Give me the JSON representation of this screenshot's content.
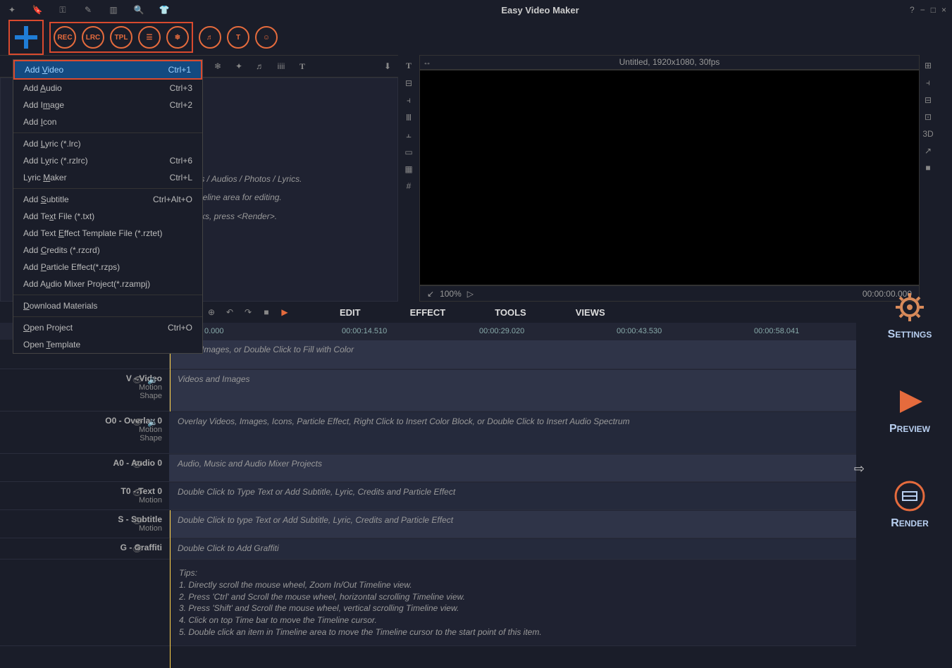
{
  "app_title": "Easy Video Maker",
  "window_controls": {
    "help": "?",
    "min": "−",
    "max": "□",
    "close": "×"
  },
  "toolbar_labels": {
    "rec": "REC",
    "lrc": "LRC",
    "tpl": "TPL"
  },
  "media_hints": {
    "line1": "/s / Audios / Photos / Lyrics.",
    "line2": "neline area for editing.",
    "line3": "rks, press <Render>."
  },
  "preview": {
    "title": "Untitled, 1920x1080, 30fps",
    "zoom": "100%",
    "timecode": "00:00:00.000"
  },
  "mid_tabs": {
    "edit": "EDIT",
    "effect": "EFFECT",
    "tools": "TOOLS",
    "views": "VIEWS"
  },
  "ruler": [
    "0.000",
    "00:00:14.510",
    "00:00:29.020",
    "00:00:43.530",
    "00:00:58.041"
  ],
  "tracks": {
    "bg": {
      "hint": "round Images, or Double Click to Fill with Color"
    },
    "video": {
      "name": "V - Video",
      "meta1": "Motion",
      "meta2": "Shape",
      "hint": "Videos and Images"
    },
    "overlay": {
      "name": "O0 - Overlay 0",
      "meta1": "Motion",
      "meta2": "Shape",
      "hint": "Overlay Videos, Images, Icons, Particle Effect, Right Click to Insert Color Block, or Double Click to Insert Audio Spectrum"
    },
    "audio": {
      "name": "A0 - Audio 0",
      "hint": "Audio, Music and Audio Mixer Projects"
    },
    "text": {
      "name": "T0 - Text 0",
      "meta1": "Motion",
      "hint": "Double Click to Type Text or Add Subtitle, Lyric, Credits and Particle Effect"
    },
    "subtitle": {
      "name": "S - Subtitle",
      "meta1": "Motion",
      "hint": "Double Click to type Text or Add Subtitle, Lyric, Credits and Particle Effect"
    },
    "graffiti": {
      "name": "G - Graffiti",
      "hint": "Double Click to Add Graffiti"
    }
  },
  "tips": {
    "title": "Tips:",
    "t1": "1. Directly scroll the mouse wheel, Zoom In/Out Timeline view.",
    "t2": "2. Press 'Ctrl' and Scroll the mouse wheel, horizontal scrolling Timeline view.",
    "t3": "3. Press 'Shift' and Scroll the mouse wheel, vertical scrolling Timeline view.",
    "t4": "4. Click on top Time bar to move the Timeline cursor.",
    "t5": "5. Double click an item in Timeline area to move the Timeline cursor to the start point of this item."
  },
  "right_actions": {
    "settings": "ETTINGS",
    "settings_s": "S",
    "preview": "REVIEW",
    "preview_p": "P",
    "render": "ENDER",
    "render_r": "R"
  },
  "menu": {
    "add_video": {
      "label_pre": "Add ",
      "label_u": "V",
      "label_post": "ideo",
      "sc": "Ctrl+1"
    },
    "add_audio": {
      "label_pre": "Add ",
      "label_u": "A",
      "label_post": "udio",
      "sc": "Ctrl+3"
    },
    "add_image": {
      "label_pre": "Add I",
      "label_u": "m",
      "label_post": "age",
      "sc": "Ctrl+2"
    },
    "add_icon": {
      "label_pre": "Add ",
      "label_u": "I",
      "label_post": "con",
      "sc": ""
    },
    "add_lyric_lrc": {
      "label_pre": "Add ",
      "label_u": "L",
      "label_post": "yric (*.lrc)",
      "sc": ""
    },
    "add_lyric_rzlrc": {
      "label_pre": "Add L",
      "label_u": "y",
      "label_post": "ric (*.rzlrc)",
      "sc": "Ctrl+6"
    },
    "lyric_maker": {
      "label_pre": "Lyric ",
      "label_u": "M",
      "label_post": "aker",
      "sc": "Ctrl+L"
    },
    "add_subtitle": {
      "label_pre": "Add ",
      "label_u": "S",
      "label_post": "ubtitle",
      "sc": "Ctrl+Alt+O"
    },
    "add_textfile": {
      "label_pre": "Add Te",
      "label_u": "x",
      "label_post": "t File (*.txt)",
      "sc": ""
    },
    "add_texteffect": {
      "label_pre": "Add Text ",
      "label_u": "E",
      "label_post": "ffect Template File (*.rztet)",
      "sc": ""
    },
    "add_credits": {
      "label_pre": "Add ",
      "label_u": "C",
      "label_post": "redits (*.rzcrd)",
      "sc": ""
    },
    "add_particle": {
      "label_pre": "Add ",
      "label_u": "P",
      "label_post": "article Effect(*.rzps)",
      "sc": ""
    },
    "add_audiomixer": {
      "label_pre": "Add A",
      "label_u": "u",
      "label_post": "dio Mixer Project(*.rzampj)",
      "sc": ""
    },
    "download": {
      "label_pre": "",
      "label_u": "D",
      "label_post": "ownload Materials",
      "sc": ""
    },
    "open_project": {
      "label_pre": "",
      "label_u": "O",
      "label_post": "pen Project",
      "sc": "Ctrl+O"
    },
    "open_template": {
      "label_pre": "Open ",
      "label_u": "T",
      "label_post": "emplate",
      "sc": ""
    }
  }
}
